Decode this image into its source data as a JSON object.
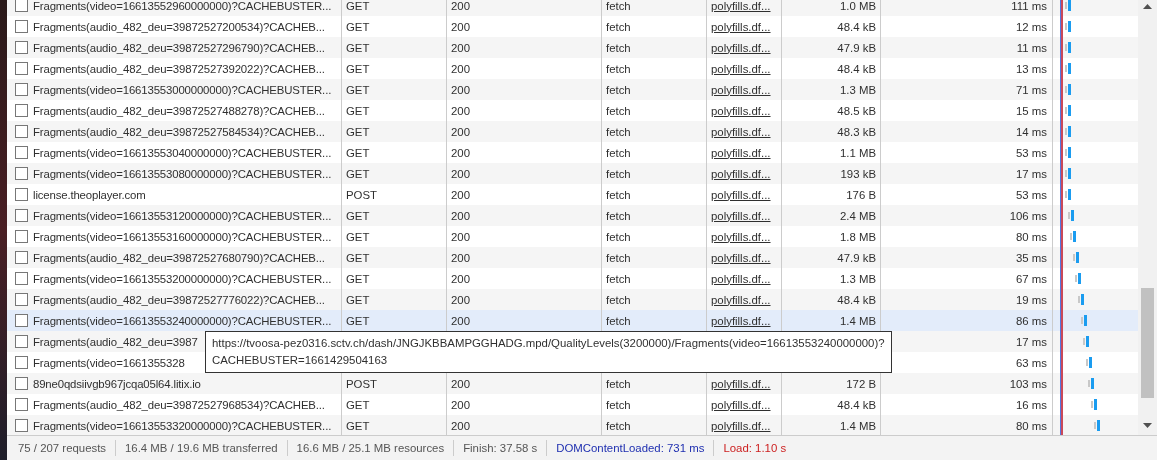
{
  "requests": [
    {
      "name": "Fragments(video=16613552960000000)?CACHEBUSTER...",
      "method": "GET",
      "status": "200",
      "type": "fetch",
      "initiator": "polyfills.df...",
      "size": "1.0 MB",
      "time": "111 ms",
      "checked": false,
      "hovered": false
    },
    {
      "name": "Fragments(audio_482_deu=39872527200534)?CACHEB...",
      "method": "GET",
      "status": "200",
      "type": "fetch",
      "initiator": "polyfills.df...",
      "size": "48.4 kB",
      "time": "12 ms",
      "checked": false,
      "hovered": false
    },
    {
      "name": "Fragments(audio_482_deu=39872527296790)?CACHEB...",
      "method": "GET",
      "status": "200",
      "type": "fetch",
      "initiator": "polyfills.df...",
      "size": "47.9 kB",
      "time": "11 ms",
      "checked": false,
      "hovered": false
    },
    {
      "name": "Fragments(audio_482_deu=39872527392022)?CACHEB...",
      "method": "GET",
      "status": "200",
      "type": "fetch",
      "initiator": "polyfills.df...",
      "size": "48.4 kB",
      "time": "13 ms",
      "checked": false,
      "hovered": false
    },
    {
      "name": "Fragments(video=16613553000000000)?CACHEBUSTER...",
      "method": "GET",
      "status": "200",
      "type": "fetch",
      "initiator": "polyfills.df...",
      "size": "1.3 MB",
      "time": "71 ms",
      "checked": false,
      "hovered": false
    },
    {
      "name": "Fragments(audio_482_deu=39872527488278)?CACHEB...",
      "method": "GET",
      "status": "200",
      "type": "fetch",
      "initiator": "polyfills.df...",
      "size": "48.5 kB",
      "time": "15 ms",
      "checked": false,
      "hovered": false
    },
    {
      "name": "Fragments(audio_482_deu=39872527584534)?CACHEB...",
      "method": "GET",
      "status": "200",
      "type": "fetch",
      "initiator": "polyfills.df...",
      "size": "48.3 kB",
      "time": "14 ms",
      "checked": false,
      "hovered": false
    },
    {
      "name": "Fragments(video=16613553040000000)?CACHEBUSTER...",
      "method": "GET",
      "status": "200",
      "type": "fetch",
      "initiator": "polyfills.df...",
      "size": "1.1 MB",
      "time": "53 ms",
      "checked": false,
      "hovered": false
    },
    {
      "name": "Fragments(video=16613553080000000)?CACHEBUSTER...",
      "method": "GET",
      "status": "200",
      "type": "fetch",
      "initiator": "polyfills.df...",
      "size": "193 kB",
      "time": "17 ms",
      "checked": false,
      "hovered": false
    },
    {
      "name": "license.theoplayer.com",
      "method": "POST",
      "status": "200",
      "type": "fetch",
      "initiator": "polyfills.df...",
      "size": "176 B",
      "time": "53 ms",
      "checked": false,
      "hovered": false
    },
    {
      "name": "Fragments(video=16613553120000000)?CACHEBUSTER...",
      "method": "GET",
      "status": "200",
      "type": "fetch",
      "initiator": "polyfills.df...",
      "size": "2.4 MB",
      "time": "106 ms",
      "checked": false,
      "hovered": false
    },
    {
      "name": "Fragments(video=16613553160000000)?CACHEBUSTER...",
      "method": "GET",
      "status": "200",
      "type": "fetch",
      "initiator": "polyfills.df...",
      "size": "1.8 MB",
      "time": "80 ms",
      "checked": false,
      "hovered": false
    },
    {
      "name": "Fragments(audio_482_deu=39872527680790)?CACHEB...",
      "method": "GET",
      "status": "200",
      "type": "fetch",
      "initiator": "polyfills.df...",
      "size": "47.9 kB",
      "time": "35 ms",
      "checked": false,
      "hovered": false
    },
    {
      "name": "Fragments(video=16613553200000000)?CACHEBUSTER...",
      "method": "GET",
      "status": "200",
      "type": "fetch",
      "initiator": "polyfills.df...",
      "size": "1.3 MB",
      "time": "67 ms",
      "checked": false,
      "hovered": false
    },
    {
      "name": "Fragments(audio_482_deu=39872527776022)?CACHEB...",
      "method": "GET",
      "status": "200",
      "type": "fetch",
      "initiator": "polyfills.df...",
      "size": "48.4 kB",
      "time": "19 ms",
      "checked": false,
      "hovered": false
    },
    {
      "name": "Fragments(video=16613553240000000)?CACHEBUSTER...",
      "method": "GET",
      "status": "200",
      "type": "fetch",
      "initiator": "polyfills.df...",
      "size": "1.4 MB",
      "time": "86 ms",
      "checked": false,
      "hovered": true
    },
    {
      "name": "Fragments(audio_482_deu=3987",
      "time": "17 ms",
      "checked": false,
      "hovered": false
    },
    {
      "name": "Fragments(video=1661355328",
      "time": "63 ms",
      "checked": false,
      "hovered": false
    },
    {
      "name": "89ne0qdsiivgb967jcqa05l64.litix.io",
      "method": "POST",
      "status": "200",
      "type": "fetch",
      "initiator": "polyfills.df...",
      "size": "172 B",
      "time": "103 ms",
      "checked": false,
      "hovered": false
    },
    {
      "name": "Fragments(audio_482_deu=39872527968534)?CACHEB...",
      "method": "GET",
      "status": "200",
      "type": "fetch",
      "initiator": "polyfills.df...",
      "size": "48.4 kB",
      "time": "16 ms",
      "checked": false,
      "hovered": false
    },
    {
      "name": "Fragments(video=16613553320000000)?CACHEBUSTER...",
      "method": "GET",
      "status": "200",
      "type": "fetch",
      "initiator": "polyfills.df...",
      "size": "1.4 MB",
      "time": "80 ms",
      "checked": false,
      "hovered": false
    }
  ],
  "tooltip": [
    "https://tvoosa-pez0316.sctv.ch/dash/JNGJKBBAMPGGHADG.mpd/QualityLevels(3200000)/Fragments(video=16613553240000000)?",
    "CACHEBUSTER=1661429504163"
  ],
  "status_bar": [
    {
      "text": "75 / 207 requests",
      "kind": "plain"
    },
    {
      "text": "16.4 MB / 19.6 MB transferred",
      "kind": "plain"
    },
    {
      "text": "16.6 MB / 25.1 MB resources",
      "kind": "plain"
    },
    {
      "text": "Finish: 37.58 s",
      "kind": "plain"
    },
    {
      "text": "DOMContentLoaded: 731 ms",
      "kind": "dom"
    },
    {
      "text": "Load: 1.10 s",
      "kind": "load"
    }
  ]
}
